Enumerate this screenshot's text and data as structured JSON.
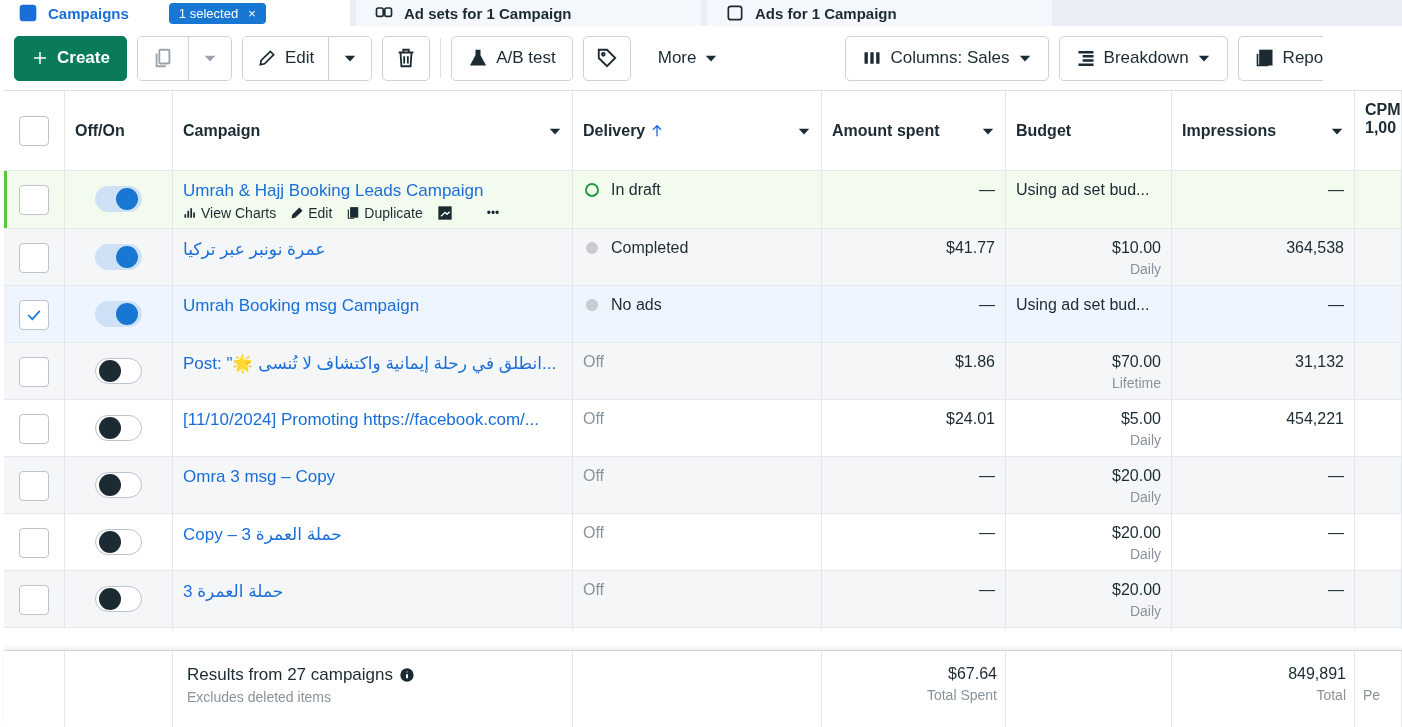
{
  "tabs": [
    {
      "label": "Campaigns",
      "selected": true,
      "badge": "1 selected",
      "badge_close": "×"
    },
    {
      "label": "Ad sets for 1 Campaign",
      "selected": false
    },
    {
      "label": "Ads for 1 Campaign",
      "selected": false
    }
  ],
  "toolbar": [
    {
      "kind": "create",
      "label": "Create"
    },
    {
      "kind": "copy",
      "disabled": true
    },
    {
      "kind": "edit",
      "label": "Edit"
    },
    {
      "kind": "delete"
    },
    {
      "kind": "divider"
    },
    {
      "kind": "abtest",
      "label": "A/B test"
    },
    {
      "kind": "tag"
    },
    {
      "kind": "more",
      "label": "More"
    },
    {
      "kind": "columns",
      "label": "Columns: Sales"
    },
    {
      "kind": "breakdown",
      "label": "Breakdown"
    },
    {
      "kind": "reports",
      "label": "Repo"
    }
  ],
  "select_all": {
    "checked": false
  },
  "columns": [
    {
      "label": "Off/On",
      "menu": false,
      "sorted": false
    },
    {
      "label": "Campaign",
      "menu": true,
      "sorted": false
    },
    {
      "label": "Delivery",
      "menu": true,
      "sorted": true
    },
    {
      "label": "Amount spent",
      "menu": true,
      "sorted": false
    },
    {
      "label": "Budget",
      "menu": false,
      "sorted": false
    },
    {
      "label": "Impressions",
      "menu": true,
      "sorted": false
    },
    {
      "label": "CPM 1,00"
    }
  ],
  "rows": [
    {
      "selected": false,
      "on": true,
      "name": "Umrah & Hajj Booking Leads Campaign",
      "actions": [
        "View Charts",
        "Edit",
        "Duplicate"
      ],
      "more": "•••",
      "kind": "draft",
      "delivery": "In draft",
      "spent": "—",
      "budget": "Using ad set bud...",
      "impressions": "—"
    },
    {
      "selected": false,
      "on": true,
      "name": "عمرة نونبر عبر تركيا",
      "kind": "completed",
      "delivery": "Completed",
      "spent": "$41.77",
      "budget": "$10.00",
      "budget_note": "Daily",
      "impressions": "364,538"
    },
    {
      "selected": true,
      "on": true,
      "name": "Umrah Booking msg Campaign",
      "kind": "inactive",
      "delivery": "No ads",
      "spent": "—",
      "budget": "Using ad set bud...",
      "impressions": "—"
    },
    {
      "selected": false,
      "on": false,
      "name": "Post: \"🌟 انطلق في رحلة إيمانية واكتشاف لا تُنسى...",
      "kind": "off",
      "delivery": "Off",
      "spent": "$1.86",
      "budget": "$70.00",
      "budget_note": "Lifetime",
      "impressions": "31,132"
    },
    {
      "selected": false,
      "on": false,
      "name": "[11/10/2024] Promoting https://facebook.com/...",
      "kind": "off",
      "delivery": "Off",
      "spent": "$24.01",
      "budget": "$5.00",
      "budget_note": "Daily",
      "impressions": "454,221"
    },
    {
      "selected": false,
      "on": false,
      "name": "Omra 3 msg – Copy",
      "kind": "off",
      "delivery": "Off",
      "spent": "—",
      "budget": "$20.00",
      "budget_note": "Daily",
      "impressions": "—"
    },
    {
      "selected": false,
      "on": false,
      "name": "حملة العمرة 3 – Copy",
      "kind": "off",
      "delivery": "Off",
      "spent": "—",
      "budget": "$20.00",
      "budget_note": "Daily",
      "impressions": "—"
    },
    {
      "selected": false,
      "on": false,
      "name": "حملة العمرة 3",
      "kind": "off",
      "delivery": "Off",
      "spent": "—",
      "budget": "$20.00",
      "budget_note": "Daily",
      "impressions": "—"
    }
  ],
  "footer": {
    "results": "Results from 27 campaigns",
    "note": "Excludes deleted items",
    "spent": "$67.64",
    "spent_label": "Total Spent",
    "impressions": "849,891",
    "impressions_label": "Total",
    "cpm_label": "Pe"
  }
}
